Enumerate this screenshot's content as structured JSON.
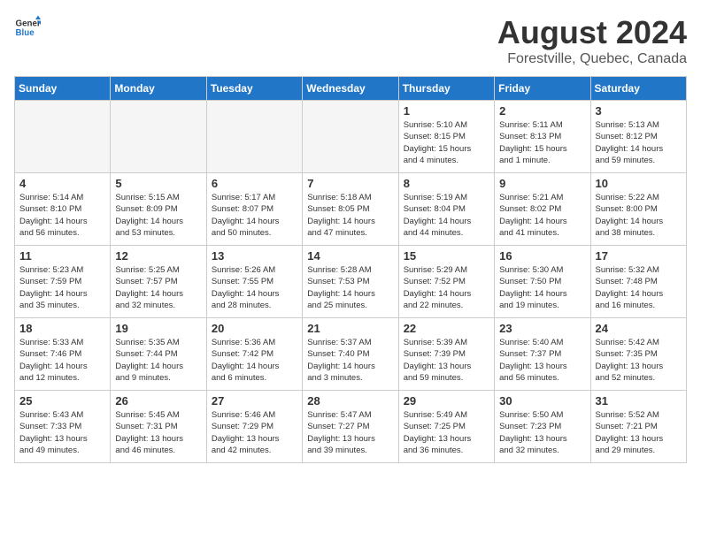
{
  "header": {
    "logo_general": "General",
    "logo_blue": "Blue",
    "month": "August 2024",
    "location": "Forestville, Quebec, Canada"
  },
  "weekdays": [
    "Sunday",
    "Monday",
    "Tuesday",
    "Wednesday",
    "Thursday",
    "Friday",
    "Saturday"
  ],
  "weeks": [
    [
      {
        "day": "",
        "info": ""
      },
      {
        "day": "",
        "info": ""
      },
      {
        "day": "",
        "info": ""
      },
      {
        "day": "",
        "info": ""
      },
      {
        "day": "1",
        "info": "Sunrise: 5:10 AM\nSunset: 8:15 PM\nDaylight: 15 hours\nand 4 minutes."
      },
      {
        "day": "2",
        "info": "Sunrise: 5:11 AM\nSunset: 8:13 PM\nDaylight: 15 hours\nand 1 minute."
      },
      {
        "day": "3",
        "info": "Sunrise: 5:13 AM\nSunset: 8:12 PM\nDaylight: 14 hours\nand 59 minutes."
      }
    ],
    [
      {
        "day": "4",
        "info": "Sunrise: 5:14 AM\nSunset: 8:10 PM\nDaylight: 14 hours\nand 56 minutes."
      },
      {
        "day": "5",
        "info": "Sunrise: 5:15 AM\nSunset: 8:09 PM\nDaylight: 14 hours\nand 53 minutes."
      },
      {
        "day": "6",
        "info": "Sunrise: 5:17 AM\nSunset: 8:07 PM\nDaylight: 14 hours\nand 50 minutes."
      },
      {
        "day": "7",
        "info": "Sunrise: 5:18 AM\nSunset: 8:05 PM\nDaylight: 14 hours\nand 47 minutes."
      },
      {
        "day": "8",
        "info": "Sunrise: 5:19 AM\nSunset: 8:04 PM\nDaylight: 14 hours\nand 44 minutes."
      },
      {
        "day": "9",
        "info": "Sunrise: 5:21 AM\nSunset: 8:02 PM\nDaylight: 14 hours\nand 41 minutes."
      },
      {
        "day": "10",
        "info": "Sunrise: 5:22 AM\nSunset: 8:00 PM\nDaylight: 14 hours\nand 38 minutes."
      }
    ],
    [
      {
        "day": "11",
        "info": "Sunrise: 5:23 AM\nSunset: 7:59 PM\nDaylight: 14 hours\nand 35 minutes."
      },
      {
        "day": "12",
        "info": "Sunrise: 5:25 AM\nSunset: 7:57 PM\nDaylight: 14 hours\nand 32 minutes."
      },
      {
        "day": "13",
        "info": "Sunrise: 5:26 AM\nSunset: 7:55 PM\nDaylight: 14 hours\nand 28 minutes."
      },
      {
        "day": "14",
        "info": "Sunrise: 5:28 AM\nSunset: 7:53 PM\nDaylight: 14 hours\nand 25 minutes."
      },
      {
        "day": "15",
        "info": "Sunrise: 5:29 AM\nSunset: 7:52 PM\nDaylight: 14 hours\nand 22 minutes."
      },
      {
        "day": "16",
        "info": "Sunrise: 5:30 AM\nSunset: 7:50 PM\nDaylight: 14 hours\nand 19 minutes."
      },
      {
        "day": "17",
        "info": "Sunrise: 5:32 AM\nSunset: 7:48 PM\nDaylight: 14 hours\nand 16 minutes."
      }
    ],
    [
      {
        "day": "18",
        "info": "Sunrise: 5:33 AM\nSunset: 7:46 PM\nDaylight: 14 hours\nand 12 minutes."
      },
      {
        "day": "19",
        "info": "Sunrise: 5:35 AM\nSunset: 7:44 PM\nDaylight: 14 hours\nand 9 minutes."
      },
      {
        "day": "20",
        "info": "Sunrise: 5:36 AM\nSunset: 7:42 PM\nDaylight: 14 hours\nand 6 minutes."
      },
      {
        "day": "21",
        "info": "Sunrise: 5:37 AM\nSunset: 7:40 PM\nDaylight: 14 hours\nand 3 minutes."
      },
      {
        "day": "22",
        "info": "Sunrise: 5:39 AM\nSunset: 7:39 PM\nDaylight: 13 hours\nand 59 minutes."
      },
      {
        "day": "23",
        "info": "Sunrise: 5:40 AM\nSunset: 7:37 PM\nDaylight: 13 hours\nand 56 minutes."
      },
      {
        "day": "24",
        "info": "Sunrise: 5:42 AM\nSunset: 7:35 PM\nDaylight: 13 hours\nand 52 minutes."
      }
    ],
    [
      {
        "day": "25",
        "info": "Sunrise: 5:43 AM\nSunset: 7:33 PM\nDaylight: 13 hours\nand 49 minutes."
      },
      {
        "day": "26",
        "info": "Sunrise: 5:45 AM\nSunset: 7:31 PM\nDaylight: 13 hours\nand 46 minutes."
      },
      {
        "day": "27",
        "info": "Sunrise: 5:46 AM\nSunset: 7:29 PM\nDaylight: 13 hours\nand 42 minutes."
      },
      {
        "day": "28",
        "info": "Sunrise: 5:47 AM\nSunset: 7:27 PM\nDaylight: 13 hours\nand 39 minutes."
      },
      {
        "day": "29",
        "info": "Sunrise: 5:49 AM\nSunset: 7:25 PM\nDaylight: 13 hours\nand 36 minutes."
      },
      {
        "day": "30",
        "info": "Sunrise: 5:50 AM\nSunset: 7:23 PM\nDaylight: 13 hours\nand 32 minutes."
      },
      {
        "day": "31",
        "info": "Sunrise: 5:52 AM\nSunset: 7:21 PM\nDaylight: 13 hours\nand 29 minutes."
      }
    ]
  ]
}
